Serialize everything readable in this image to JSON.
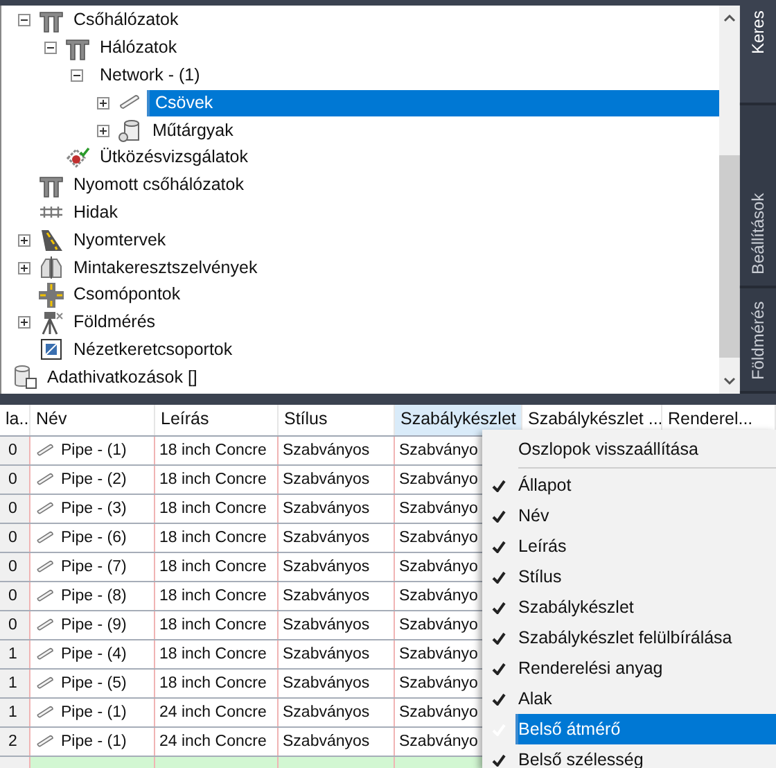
{
  "tree": {
    "items": [
      {
        "children": [
          {
            "label": "Csőhálózatok",
            "kind": "pipes",
            "expanded": true,
            "selected": false,
            "children": [
              {
                "label": "Hálózatok",
                "kind": "pipes",
                "expanded": true,
                "selected": false,
                "children": [
                  {
                    "label": "Network - (1)",
                    "kind": "none",
                    "expanded": true,
                    "selected": false,
                    "children": [
                      {
                        "label": "Csövek",
                        "kind": "pipe",
                        "expanded": false,
                        "selected": true
                      },
                      {
                        "label": "Műtárgyak",
                        "kind": "structure",
                        "expanded": false,
                        "selected": false
                      }
                    ]
                  }
                ]
              },
              {
                "label": "Ütközésvizsgálatok",
                "kind": "interference",
                "selected": false
              }
            ]
          },
          {
            "label": "Nyomott csőhálózatok",
            "kind": "pipes",
            "selected": false
          },
          {
            "label": "Hidak",
            "kind": "bridge",
            "selected": false
          },
          {
            "label": "Nyomtervek",
            "kind": "road",
            "expanded": false,
            "selected": false
          },
          {
            "label": "Mintakeresztszelvények",
            "kind": "section",
            "expanded": false,
            "selected": false
          },
          {
            "label": "Csomópontok",
            "kind": "intersection",
            "selected": false
          },
          {
            "label": "Földmérés",
            "kind": "survey",
            "expanded": false,
            "selected": false
          },
          {
            "label": "Nézetkeretcsoportok",
            "kind": "frame",
            "selected": false
          }
        ]
      },
      {
        "label": "Adathivatkozások []",
        "kind": "dataref",
        "selected": false
      }
    ]
  },
  "side_tabs": [
    {
      "label": "Keres",
      "selected": true
    },
    {
      "label": "Beállítások",
      "selected": false
    },
    {
      "label": "Földmérés",
      "selected": false
    }
  ],
  "table": {
    "columns": [
      {
        "label": "la...",
        "selected": false
      },
      {
        "label": "Név",
        "selected": false
      },
      {
        "label": "Leírás",
        "selected": false
      },
      {
        "label": "Stílus",
        "selected": false
      },
      {
        "label": "Szabálykészlet",
        "selected": true
      },
      {
        "label": "Szabálykészlet ...",
        "selected": false
      },
      {
        "label": "Renderel...",
        "selected": false
      }
    ],
    "rows": [
      [
        "0",
        "Pipe - (1)",
        "18 inch Concre",
        "Szabványos",
        "Szabványo"
      ],
      [
        "0",
        "Pipe - (2)",
        "18 inch Concre",
        "Szabványos",
        "Szabványo"
      ],
      [
        "0",
        "Pipe - (3)",
        "18 inch Concre",
        "Szabványos",
        "Szabványo"
      ],
      [
        "0",
        "Pipe - (6)",
        "18 inch Concre",
        "Szabványos",
        "Szabványo"
      ],
      [
        "0",
        "Pipe - (7)",
        "18 inch Concre",
        "Szabványos",
        "Szabványo"
      ],
      [
        "0",
        "Pipe - (8)",
        "18 inch Concre",
        "Szabványos",
        "Szabványo"
      ],
      [
        "0",
        "Pipe - (9)",
        "18 inch Concre",
        "Szabványos",
        "Szabványo"
      ],
      [
        "1",
        "Pipe - (4)",
        "18 inch Concre",
        "Szabványos",
        "Szabványo"
      ],
      [
        "1",
        "Pipe - (5)",
        "18 inch Concre",
        "Szabványos",
        "Szabványo"
      ],
      [
        "1",
        "Pipe - (1)",
        "24 inch Concre",
        "Szabványos",
        "Szabványo"
      ],
      [
        "2",
        "Pipe - (1)",
        "24 inch Concre",
        "Szabványos",
        "Szabványo"
      ]
    ]
  },
  "context_menu": {
    "items": [
      {
        "label": "Oszlopok visszaállítása",
        "kind": "command",
        "selected": false
      },
      {
        "label": "Állapot",
        "kind": "toggle",
        "checked": true,
        "selected": false
      },
      {
        "label": "Név",
        "kind": "toggle",
        "checked": true,
        "selected": false
      },
      {
        "label": "Leírás",
        "kind": "toggle",
        "checked": true,
        "selected": false
      },
      {
        "label": "Stílus",
        "kind": "toggle",
        "checked": true,
        "selected": false
      },
      {
        "label": "Szabálykészlet",
        "kind": "toggle",
        "checked": true,
        "selected": false
      },
      {
        "label": "Szabálykészlet felülbírálása",
        "kind": "toggle",
        "checked": true,
        "selected": false
      },
      {
        "label": "Renderelési anyag",
        "kind": "toggle",
        "checked": true,
        "selected": false
      },
      {
        "label": "Alak",
        "kind": "toggle",
        "checked": true,
        "selected": false
      },
      {
        "label": "Belső átmérő",
        "kind": "toggle",
        "checked": true,
        "selected": true
      },
      {
        "label": "Belső szélesség",
        "kind": "toggle",
        "checked": true,
        "selected": false
      }
    ]
  }
}
